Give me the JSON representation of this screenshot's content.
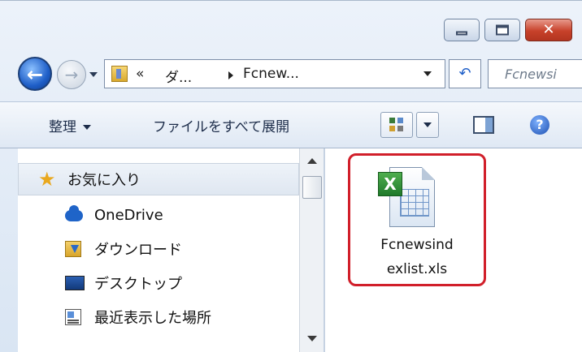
{
  "window": {
    "minimize_glyph": "—",
    "maximize_glyph": "□",
    "close_glyph": "✕"
  },
  "nav": {
    "back_glyph": "←",
    "forward_glyph": "→",
    "breadcrumb": [
      "«",
      "ダ...",
      "Fcnew..."
    ],
    "refresh_glyph": "↶",
    "search_placeholder": "Fcnewsi"
  },
  "toolbar": {
    "organize_label": "整理",
    "expand_all_label": "ファイルをすべて展開",
    "help_glyph": "?"
  },
  "sidebar": {
    "items": [
      {
        "label": "お気に入り",
        "icon": "star-icon"
      },
      {
        "label": "OneDrive",
        "icon": "onedrive-icon"
      },
      {
        "label": "ダウンロード",
        "icon": "downloads-folder-icon"
      },
      {
        "label": "デスクトップ",
        "icon": "desktop-icon"
      },
      {
        "label": "最近表示した場所",
        "icon": "recent-places-icon"
      }
    ]
  },
  "content": {
    "file": {
      "name_line1": "Fcnewsind",
      "name_line2": "exlist.xls",
      "icon": "excel-file-icon",
      "badge": "X"
    }
  },
  "colors": {
    "highlight_border": "#d11f2a",
    "close_button": "#c7412a",
    "excel_green": "#1f7a2a"
  }
}
